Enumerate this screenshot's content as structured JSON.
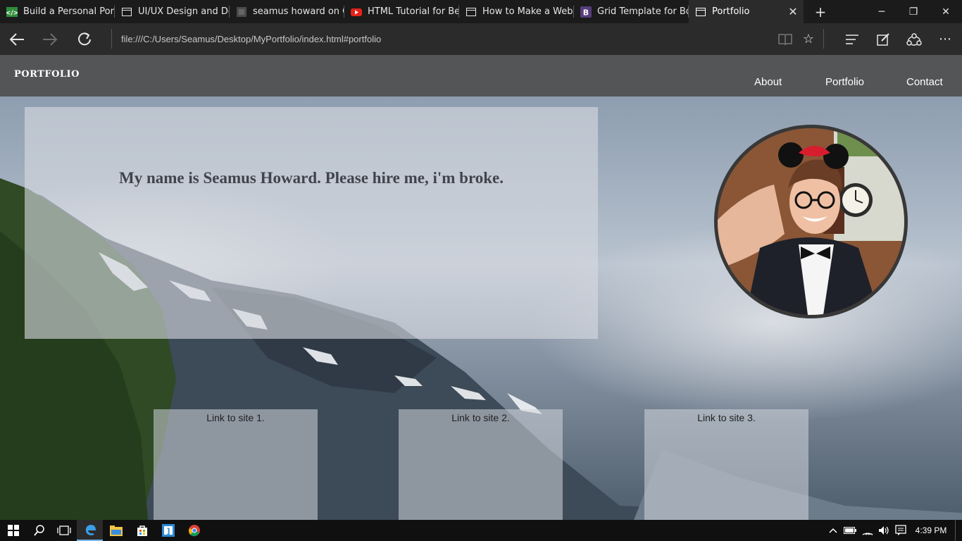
{
  "browser": {
    "tabs": [
      {
        "title": "Build a Personal Portfo",
        "icon": "code-course-icon",
        "icon_color": "#2f8d3b"
      },
      {
        "title": "UI/UX Design and Dev",
        "icon": "page-icon",
        "icon_color": "#e6e6e6"
      },
      {
        "title": "seamus howard on Cc",
        "icon": "codepen-icon",
        "icon_color": "#555555"
      },
      {
        "title": "HTML Tutorial for Beg",
        "icon": "youtube-icon",
        "icon_color": "#e62117"
      },
      {
        "title": "How to Make a Websi",
        "icon": "page-icon",
        "icon_color": "#e6e6e6"
      },
      {
        "title": "Grid Template for Boo",
        "icon": "bootstrap-icon",
        "icon_color": "#563d7c"
      },
      {
        "title": "Portfolio",
        "icon": "page-icon",
        "icon_color": "#ffffff"
      }
    ],
    "address": "file:///C:/Users/Seamus/Desktop/MyPortfolio/index.html#portfolio"
  },
  "site": {
    "brand": "PORTFOLIO",
    "nav": {
      "about": "About",
      "portfolio": "Portfolio",
      "contact": "Contact"
    },
    "hero_text": "My name is Seamus Howard. Please hire me, i'm broke.",
    "links": [
      "Link to site 1.",
      "Link to site 2.",
      "Link to site 3."
    ]
  },
  "taskbar": {
    "time": "4:39 PM",
    "accent": "#76b9ed"
  }
}
